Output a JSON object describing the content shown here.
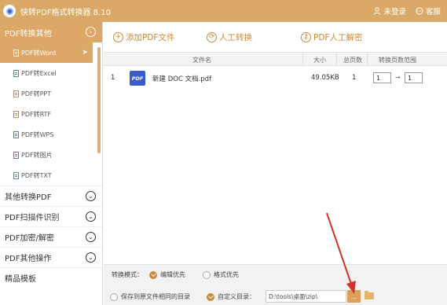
{
  "app": {
    "title": "快转PDF格式转换器 8.10",
    "login_label": "未登录",
    "service_label": "客服"
  },
  "sidebar": {
    "active_group": {
      "label": "PDF转换其他",
      "icon": "chevron-circle-icon"
    },
    "items": [
      {
        "label": "PDF转Word",
        "active": true
      },
      {
        "label": "PDF转Excel",
        "active": false
      },
      {
        "label": "PDF转PPT",
        "active": false
      },
      {
        "label": "PDF转RTF",
        "active": false
      },
      {
        "label": "PDF转WPS",
        "active": false
      },
      {
        "label": "PDF转图片",
        "active": false
      },
      {
        "label": "PDF转TXT",
        "active": false
      }
    ],
    "groups": [
      {
        "label": "其他转换PDF"
      },
      {
        "label": "PDF扫描件识别"
      },
      {
        "label": "PDF加密/解密"
      },
      {
        "label": "PDF其他操作"
      },
      {
        "label": "精品模板"
      }
    ]
  },
  "toolbar": {
    "add_label": "添加PDF文件",
    "manual_label": "人工转换",
    "decrypt_label": "PDF人工解密"
  },
  "table": {
    "columns": {
      "name": "文件名",
      "size": "大小",
      "pages": "总页数",
      "range": "转换页数范围"
    },
    "rows": [
      {
        "index": "1",
        "icon": "PDF",
        "name": "新建 DOC 文档.pdf",
        "size": "49.05KB",
        "pages": "1",
        "from": "1",
        "to": "1"
      }
    ]
  },
  "bottom": {
    "mode_label": "转换模式：",
    "mode_options": [
      {
        "label": "编辑优先",
        "checked": true
      },
      {
        "label": "格式优先",
        "checked": false
      }
    ],
    "save_same_label": "保存到原文件相同的目录",
    "custom_dir_label": "自定义目录：",
    "output_path": "D:\\tools\\桌面\\zip\\",
    "browse_label": "..."
  },
  "colors": {
    "accent": "#dba967",
    "arrow": "#d0342c",
    "pdf_icon": "#3a5cc8"
  }
}
